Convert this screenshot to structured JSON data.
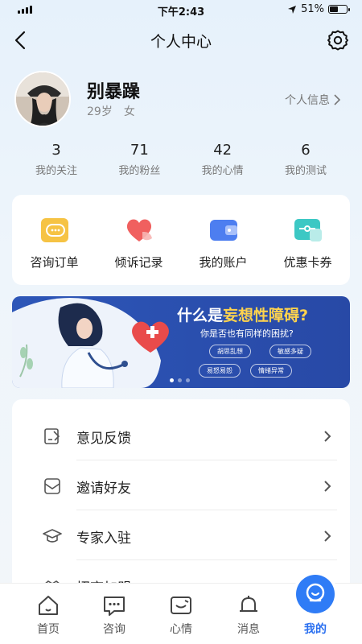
{
  "status_bar": {
    "time": "下午2:43",
    "battery": "51%",
    "battery_level": 0.51
  },
  "nav": {
    "title": "个人中心"
  },
  "profile": {
    "name": "别暴躁",
    "age": "29岁",
    "gender": "女",
    "link_label": "个人信息"
  },
  "stats": [
    {
      "num": "3",
      "label": "我的关注"
    },
    {
      "num": "71",
      "label": "我的粉丝"
    },
    {
      "num": "42",
      "label": "我的心情"
    },
    {
      "num": "6",
      "label": "我的测试"
    }
  ],
  "quick": [
    {
      "label": "咨询订单",
      "icon": "chat-bubble-icon",
      "color": "#f6c344"
    },
    {
      "label": "倾诉记录",
      "icon": "heart-icon",
      "color": "#f0605f"
    },
    {
      "label": "我的账户",
      "icon": "wallet-icon",
      "color": "#4d7ef0"
    },
    {
      "label": "优惠卡券",
      "icon": "coupon-icon",
      "color": "#3cc8c4"
    }
  ],
  "banner": {
    "title_prefix": "什么是",
    "title_highlight": "妄想性障碍?",
    "subtitle": "你是否也有同样的困扰?",
    "tags": [
      "胡思乱想",
      "敏感多疑",
      "易怒易怨",
      "情绪异常"
    ],
    "slide_count": 3,
    "active_slide": 1
  },
  "menu": [
    {
      "label": "意见反馈",
      "icon": "feedback-icon"
    },
    {
      "label": "邀请好友",
      "icon": "invite-icon"
    },
    {
      "label": "专家入驻",
      "icon": "graduation-cap-icon"
    },
    {
      "label": "招商加盟",
      "icon": "handshake-icon"
    }
  ],
  "tabs": [
    {
      "label": "首页",
      "icon": "home-icon"
    },
    {
      "label": "咨询",
      "icon": "chat-icon"
    },
    {
      "label": "心情",
      "icon": "mood-icon"
    },
    {
      "label": "消息",
      "icon": "bell-icon"
    },
    {
      "label": "我的",
      "icon": "profile-icon",
      "active": true
    }
  ],
  "colors": {
    "accent": "#2a6ff0",
    "banner_bg": "#2849a6",
    "banner_highlight": "#ffd34d"
  }
}
